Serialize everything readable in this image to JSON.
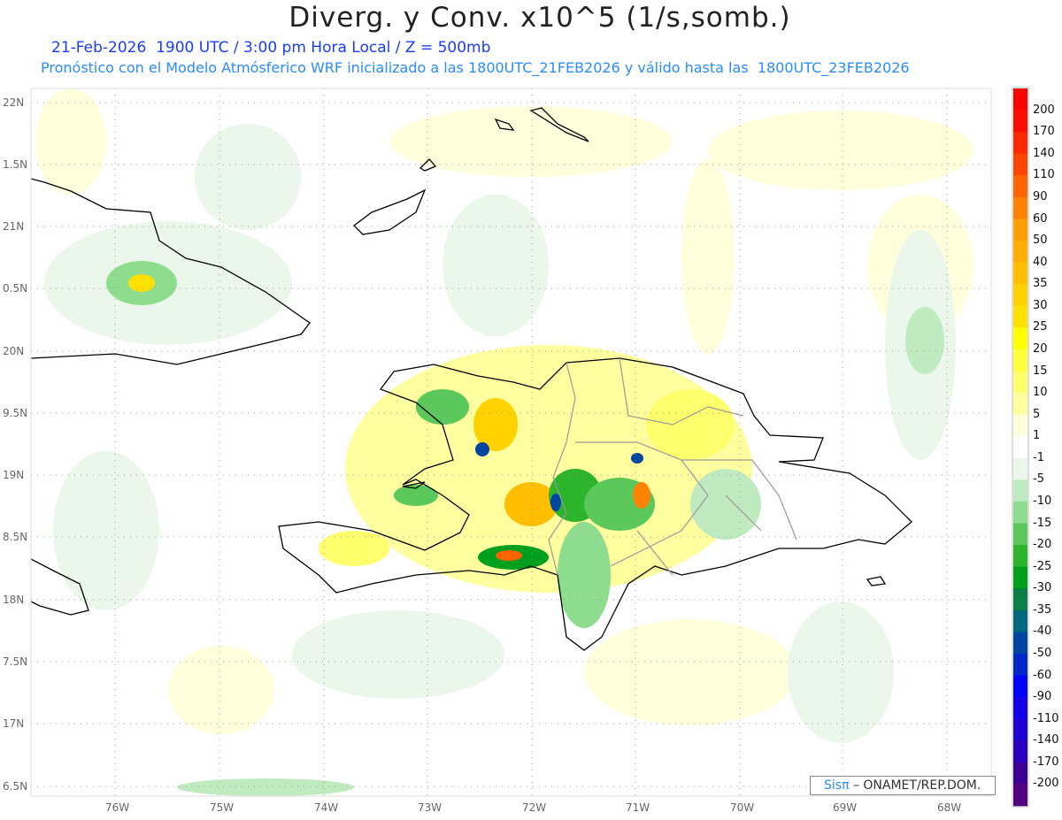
{
  "header": {
    "title": "Diverg. y Conv. x10^5 (1/s,somb.)",
    "subtitle_time": "21-Feb-2026  1900 UTC / 3:00 pm Hora Local / Z = 500mb",
    "subtitle_model": "Pronóstico con el Modelo Atmósferico WRF inicializado a las 1800UTC_21FEB2026 y válido hasta las  1800UTC_23FEB2026"
  },
  "axes": {
    "lat_labels": [
      "22N",
      "1.5N",
      "21N",
      "0.5N",
      "20N",
      "9.5N",
      "19N",
      "8.5N",
      "18N",
      "7.5N",
      "17N",
      "6.5N"
    ],
    "lon_labels": [
      "76W",
      "75W",
      "74W",
      "73W",
      "72W",
      "71W",
      "70W",
      "69W",
      "68W"
    ]
  },
  "colorbar": {
    "labels": [
      "200",
      "170",
      "140",
      "110",
      "90",
      "60",
      "50",
      "40",
      "35",
      "30",
      "25",
      "20",
      "15",
      "10",
      "5",
      "1",
      "-1",
      "-5",
      "-10",
      "-15",
      "-20",
      "-25",
      "-30",
      "-35",
      "-40",
      "-50",
      "-60",
      "-90",
      "-110",
      "-140",
      "-170",
      "-200"
    ],
    "colors": [
      "#ff0000",
      "#ff0c00",
      "#ff2800",
      "#ff4600",
      "#ff6400",
      "#ff8200",
      "#ffa000",
      "#ffaf00",
      "#ffbe00",
      "#ffd200",
      "#ffe100",
      "#ffff00",
      "#ffff3c",
      "#ffff6e",
      "#ffffa0",
      "#ffffdc",
      "#ffffff",
      "#ebf7eb",
      "#c0ebc0",
      "#8edc8e",
      "#5ac85a",
      "#2db42d",
      "#00a01e",
      "#0a7f48",
      "#00687a",
      "#0046a0",
      "#0028c8",
      "#0000ff",
      "#1400e6",
      "#1e00d2",
      "#2800be",
      "#3c0096",
      "#500080"
    ]
  },
  "credit": {
    "brand": "Sisπ",
    "text": "– ONAMET/REP.DOM."
  }
}
